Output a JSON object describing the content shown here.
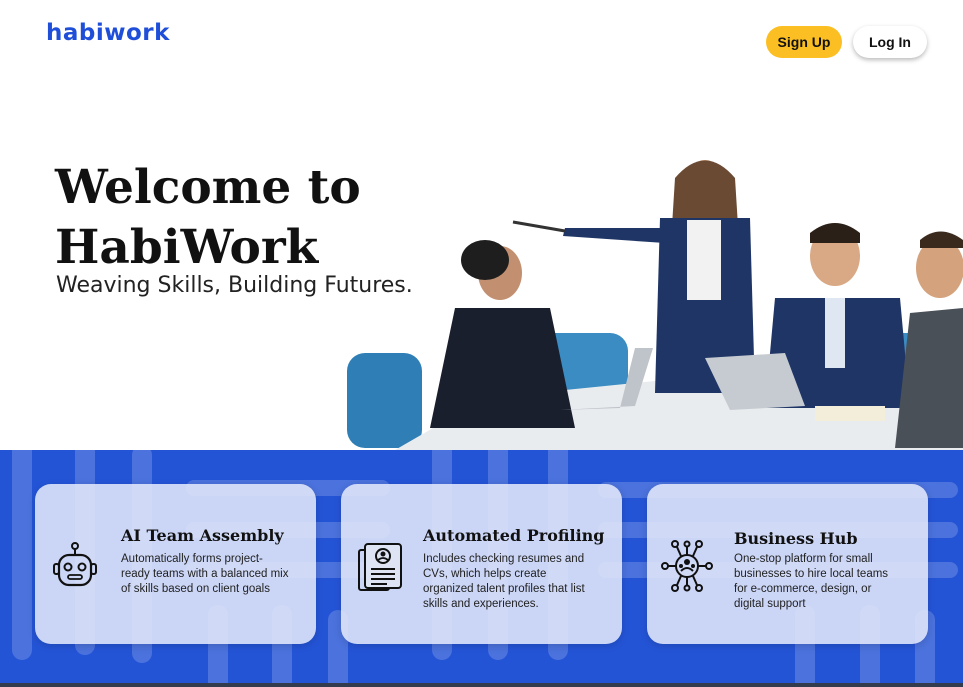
{
  "header": {
    "logo_text": "habiwork",
    "signup_label": "Sign Up",
    "login_label": "Log In"
  },
  "hero": {
    "title": "Welcome to HabiWork",
    "subtitle": "Weaving Skills, Building Futures."
  },
  "features": [
    {
      "title": "AI Team Assembly",
      "description": "Automatically forms project-ready teams with a balanced mix of skills based on client goals",
      "icon": "robot-icon"
    },
    {
      "title": "Automated Profiling",
      "description": "Includes checking resumes and CVs, which helps create organized talent profiles that list skills and experiences.",
      "icon": "resume-document-icon"
    },
    {
      "title": "Business Hub",
      "description": "One-stop platform for small businesses to hire local teams for e-commerce, design, or digital support",
      "icon": "network-people-icon"
    }
  ],
  "colors": {
    "brand_blue": "#1f4fd8",
    "band_blue": "#2454d6",
    "signup_yellow": "#fcbf23"
  }
}
